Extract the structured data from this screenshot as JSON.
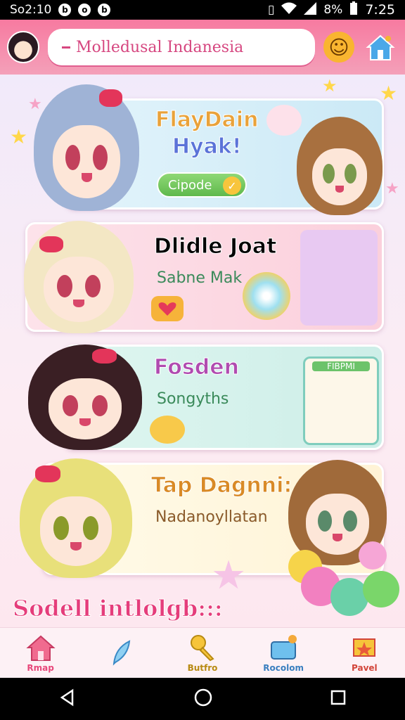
{
  "status_bar": {
    "left_text": "So2:10",
    "left_icons": [
      "b-app-icon",
      "o-app-icon",
      "b-app-icon"
    ],
    "battery": "8%",
    "time": "7:25"
  },
  "header": {
    "search_text": "Molledusal Indanesia",
    "search_value": "Molledusal Indanesia"
  },
  "cards": [
    {
      "title_line1": "FlayDain",
      "title_line2": "Hyak!",
      "button_label": "Cipode",
      "title_color": "#e9a23a",
      "title2_color": "#5b73d8"
    },
    {
      "title": "Dlidle Joat",
      "subtitle": "Sabne Mak",
      "title_color": "#e66c3a"
    },
    {
      "title": "Fosden",
      "subtitle": "Songyths",
      "title_color": "#b04bb0",
      "badge": "FIBPMI"
    },
    {
      "title": "Tap Dagnni:",
      "subtitle": "Nadanoyllatan",
      "title_color": "#d98a26"
    }
  ],
  "banner_text": "Sodell intlolgb:::",
  "bottom_nav": [
    {
      "label": "Rmap",
      "icon": "home-icon",
      "color": "#e8477a"
    },
    {
      "label": "",
      "icon": "feather-icon",
      "color": "#5cb3e6"
    },
    {
      "label": "Butfro",
      "icon": "key-icon",
      "color": "#b88a12"
    },
    {
      "label": "Rocolom",
      "icon": "toolbox-icon",
      "color": "#3a7fbf"
    },
    {
      "label": "Pavel",
      "icon": "star-badge-icon",
      "color": "#d2453a"
    }
  ],
  "colors": {
    "topbar": "#f77aa0",
    "accent_pink": "#e53d7b"
  }
}
